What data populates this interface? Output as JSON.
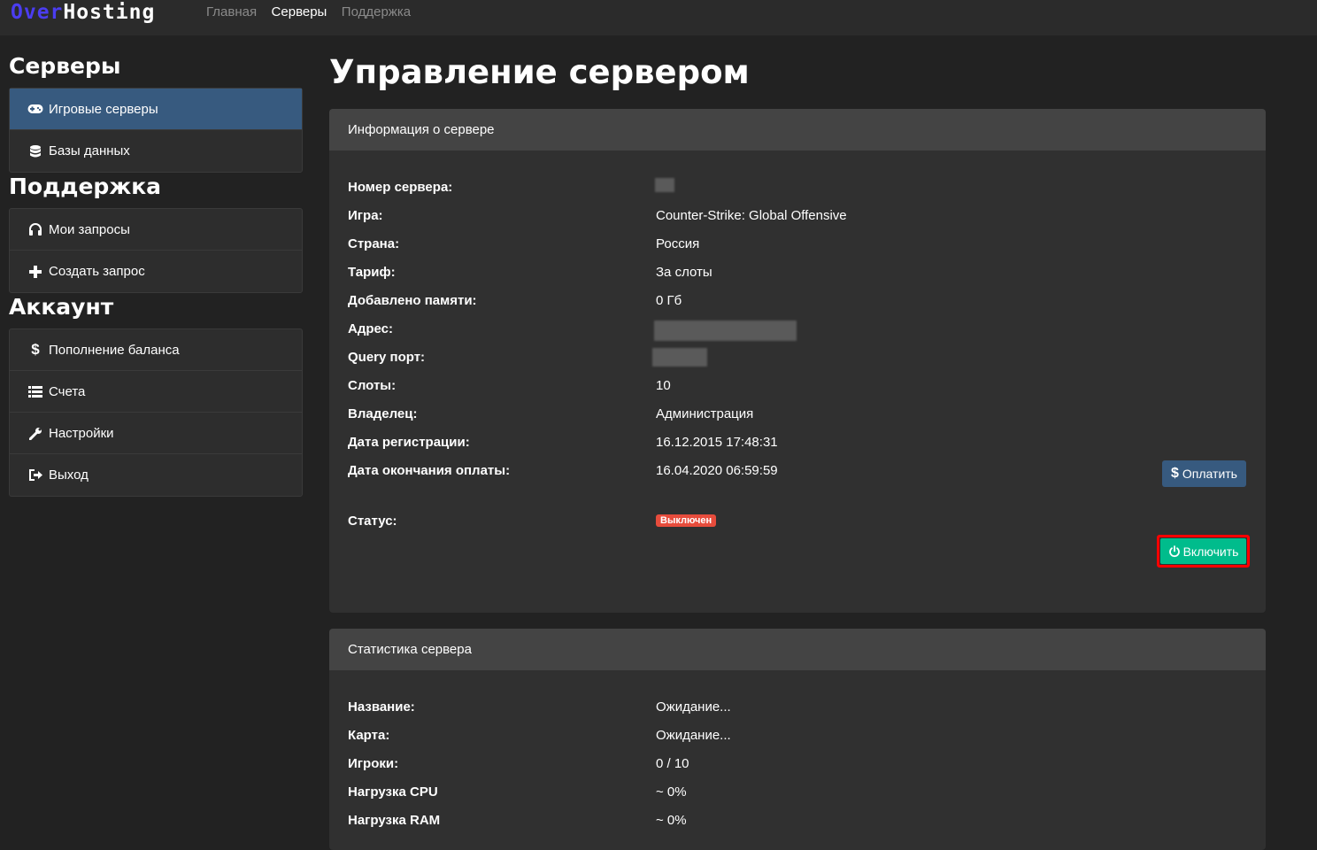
{
  "navbar": {
    "logo_part1": "Over",
    "logo_part2": "Hosting",
    "links": [
      "Главная",
      "Серверы",
      "Поддержка"
    ]
  },
  "sidebar": {
    "servers_title": "Серверы",
    "servers_items": [
      {
        "label": "Игровые серверы",
        "icon": "gamepad-icon"
      },
      {
        "label": "Базы данных",
        "icon": "database-icon"
      }
    ],
    "support_title": "Поддержка",
    "support_items": [
      {
        "label": "Мои запросы",
        "icon": "headphones-icon"
      },
      {
        "label": "Создать запрос",
        "icon": "plus-icon"
      }
    ],
    "account_title": "Аккаунт",
    "account_items": [
      {
        "label": "Пополнение баланса",
        "icon": "dollar-icon"
      },
      {
        "label": "Счета",
        "icon": "list-icon"
      },
      {
        "label": "Настройки",
        "icon": "wrench-icon"
      },
      {
        "label": "Выход",
        "icon": "logout-icon"
      }
    ]
  },
  "main": {
    "title": "Управление сервером",
    "info_panel": {
      "heading": "Информация о сервере",
      "rows": [
        {
          "label": "Номер сервера:",
          "value": ""
        },
        {
          "label": "Игра:",
          "value": "Counter-Strike: Global Offensive"
        },
        {
          "label": "Страна:",
          "value": "Россия"
        },
        {
          "label": "Тариф:",
          "value": "За слоты"
        },
        {
          "label": "Добавлено памяти:",
          "value": "0 Гб"
        },
        {
          "label": "Адрес:",
          "value": ""
        },
        {
          "label": "Query порт:",
          "value": ""
        },
        {
          "label": "Слоты:",
          "value": "10"
        },
        {
          "label": "Владелец:",
          "value": "Администрация"
        },
        {
          "label": "Дата регистрации:",
          "value": "16.12.2015 17:48:31"
        },
        {
          "label": "Дата окончания оплаты:",
          "value": "16.04.2020 06:59:59"
        }
      ],
      "status_label": "Статус:",
      "status_badge": "Выключен",
      "pay_button": "Оплатить",
      "start_button": "Включить"
    },
    "stats_panel": {
      "heading": "Статистика сервера",
      "rows": [
        {
          "label": "Название:",
          "value": "Ожидание..."
        },
        {
          "label": "Карта:",
          "value": "Ожидание..."
        },
        {
          "label": "Игроки:",
          "value": "0 / 10"
        },
        {
          "label": "Нагрузка CPU",
          "value": "~ 0%"
        },
        {
          "label": "Нагрузка RAM",
          "value": "~ 0%"
        }
      ]
    }
  },
  "colors": {
    "accent_blue": "#375a7f",
    "success": "#00bc8c",
    "danger": "#e74c3c",
    "logo_blue": "#4b3df0"
  }
}
